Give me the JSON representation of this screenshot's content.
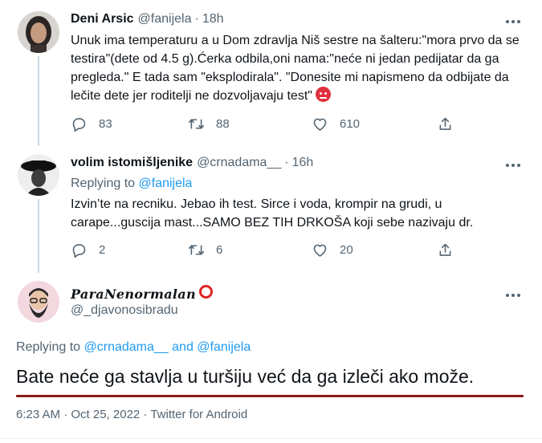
{
  "tweets": [
    {
      "name": "Deni Arsic",
      "handle": "@fanijela",
      "dot": "·",
      "time": "18h",
      "text": "Unuk ima temperaturu a u Dom zdravlja Niš sestre na šalteru:\"mora prvo da se testira\"(dete od 4.5 g).Ćerka odbila,oni nama:\"neće ni jedan pedijatar da ga pregleda.\" E tada sam \"eksplodirala\". \"Donesite mi napismeno da odbijate da lečite dete jer roditelji ne dozvoljavaju test\"",
      "emoji": "angry-face-emoji",
      "replies": "83",
      "retweets": "88",
      "likes": "610"
    },
    {
      "name": "volim istomišljenike",
      "handle": "@crnadama__",
      "dot": "·",
      "time": "16h",
      "replying_prefix": "Replying to",
      "replying_to": "@fanijela",
      "text": "Izvin’te na recniku. Jebao ih test. Sirce i voda, krompir na grudi, u carape...guscija mast...SAMO BEZ TIH DRKOŠA koji sebe nazivaju dr.",
      "replies": "2",
      "retweets": "6",
      "likes": "20"
    }
  ],
  "main_tweet": {
    "name": "ParaNenormalan",
    "handle": "@_djavonosibradu",
    "replying_prefix": "Replying to",
    "replying_user_1": "@crnadama__",
    "replying_and": "and",
    "replying_user_2": "@fanijela",
    "text": "Bate neće ga stavlja u turšiju već da ga izleči ako može.",
    "meta": "6:23 AM · Oct 25, 2022 · Twitter for Android",
    "badge_color": "#e02424",
    "underline_color": "#8b1a1a"
  },
  "colors": {
    "link": "#1d9bf0",
    "secondary_text": "#536471",
    "thread_line": "#cfd9de"
  },
  "icons": [
    "more-icon",
    "reply-icon",
    "retweet-icon",
    "like-icon",
    "share-icon",
    "angry-face-emoji",
    "ring-badge-icon"
  ]
}
